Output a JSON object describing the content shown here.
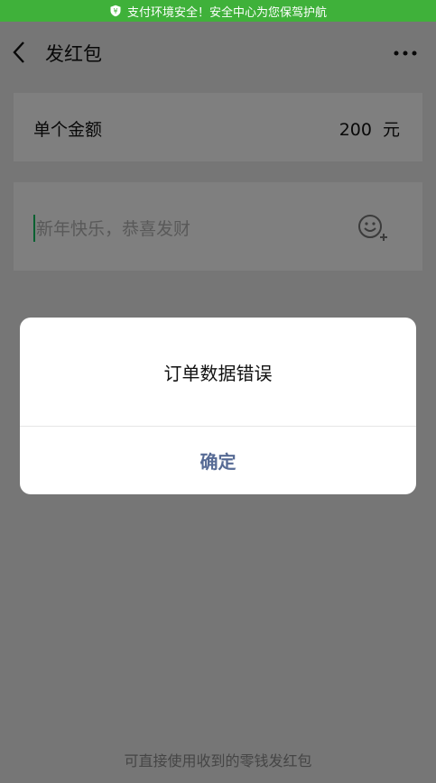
{
  "banner": {
    "text": "支付环境安全！安全中心为您保驾护航",
    "icon": "shield-icon"
  },
  "navbar": {
    "title": "发红包",
    "back_icon": "back-arrow-icon",
    "more_icon": "more-dots-icon"
  },
  "amount": {
    "label": "单个金额",
    "value": "200",
    "unit": "元"
  },
  "message": {
    "placeholder": "新年快乐，恭喜发财",
    "emoji_icon": "emoji-add-icon"
  },
  "footer": {
    "hint": "可直接使用收到的零钱发红包"
  },
  "dialog": {
    "message": "订单数据错误",
    "confirm_label": "确定"
  },
  "colors": {
    "banner": "#3fb13a",
    "link": "#576b95",
    "accent": "#07c160"
  }
}
